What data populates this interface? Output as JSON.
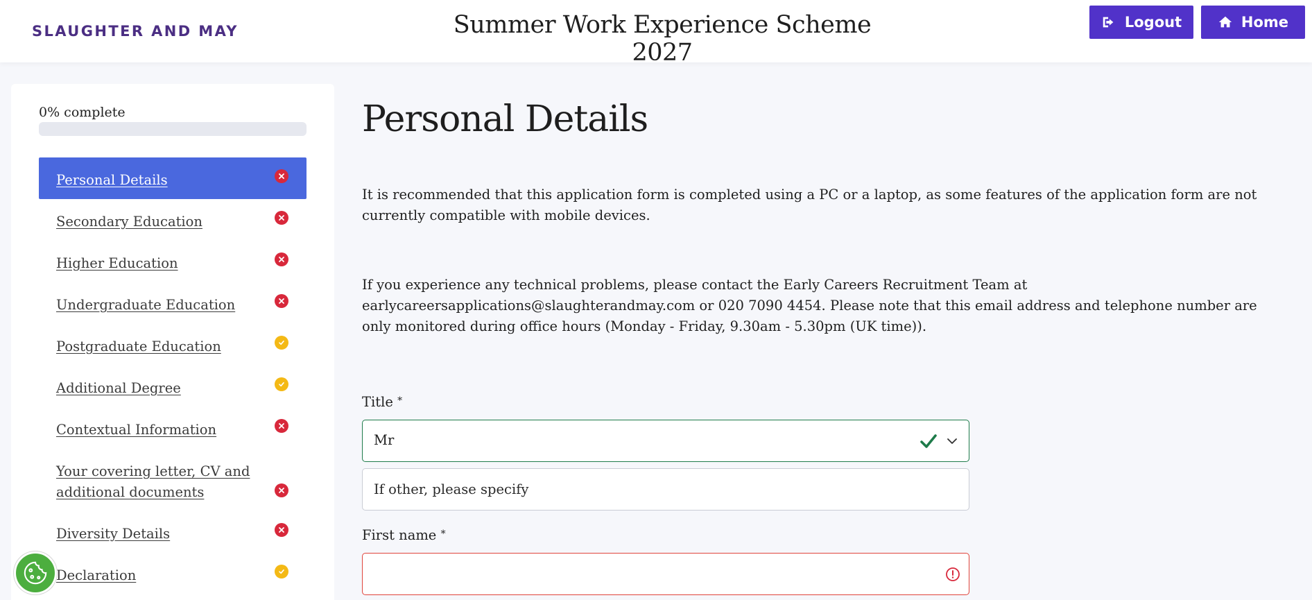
{
  "header": {
    "logo": "SLAUGHTER AND MAY",
    "title": "Summer Work Experience Scheme 2027",
    "logout_label": "Logout",
    "home_label": "Home",
    "brand_color": "#5132c9"
  },
  "sidebar": {
    "progress_label": "0% complete",
    "progress_fraction": 0,
    "items": [
      {
        "label": "Personal Details",
        "status": "error",
        "active": true
      },
      {
        "label": "Secondary Education",
        "status": "error"
      },
      {
        "label": "Higher Education",
        "status": "error"
      },
      {
        "label": "Undergraduate Education",
        "status": "error"
      },
      {
        "label": "Postgraduate Education",
        "status": "complete"
      },
      {
        "label": "Additional Degree",
        "status": "complete"
      },
      {
        "label": "Contextual Information",
        "status": "error"
      },
      {
        "label": "Your covering letter, CV and additional documents",
        "status": "error"
      },
      {
        "label": "Diversity Details",
        "status": "error"
      },
      {
        "label": "Declaration",
        "status": "complete"
      }
    ]
  },
  "main": {
    "page_title": "Personal Details",
    "paragraph_1": "It is recommended that this application form is completed using a PC or a laptop, as some features of the application form are not currently compatible with mobile devices.",
    "paragraph_2": "If you experience any technical problems, please contact the Early Careers Recruitment Team at earlycareersapplications@slaughterandmay.com or 020 7090 4454. Please note that this email address and telephone number are only monitored during office hours (Monday - Friday, 9.30am - 5.30pm (UK time)).",
    "form": {
      "title_label": "Title",
      "title_value": "Mr",
      "other_placeholder": "If other, please specify",
      "first_name_label": "First name",
      "first_name_value": "",
      "required_marker": "*"
    }
  },
  "icons": {
    "logout": "logout-icon",
    "home": "home-icon",
    "error": "error-x-icon",
    "complete": "check-circle-icon",
    "valid": "check-icon",
    "dropdown": "chevron-down-icon",
    "invalid": "alert-circle-icon",
    "cookie": "cookie-icon"
  }
}
